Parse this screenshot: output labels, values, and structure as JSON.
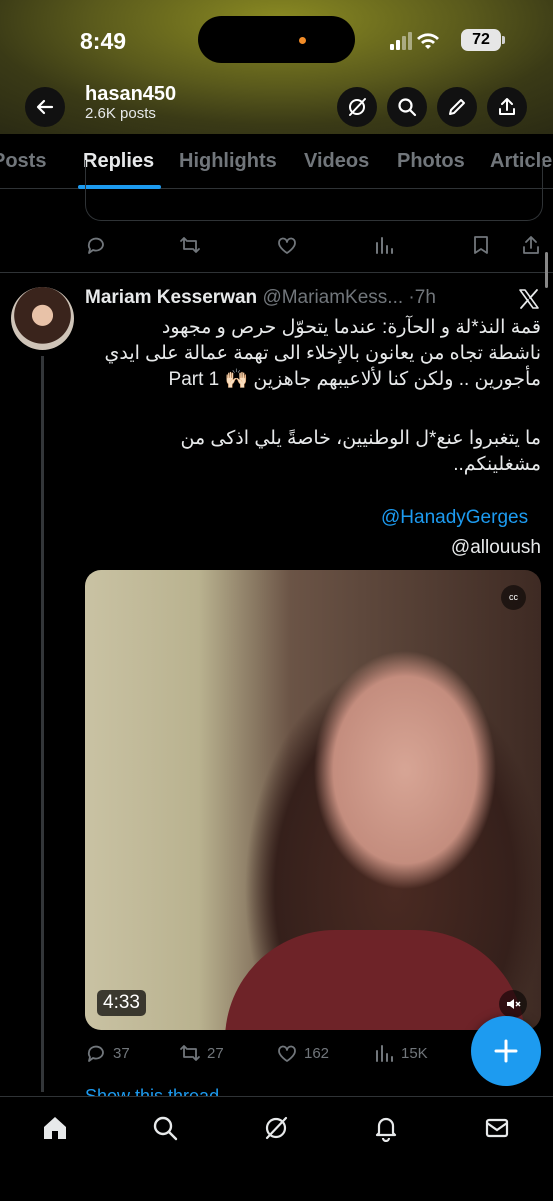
{
  "status_bar": {
    "time": "8:49",
    "battery": "72"
  },
  "profile": {
    "name": "hasan450",
    "posts": "2.6K posts"
  },
  "tabs": [
    "Posts",
    "Replies",
    "Highlights",
    "Videos",
    "Photos",
    "Articles"
  ],
  "active_tab": "Replies",
  "tweet": {
    "author_name": "Mariam Kesserwan",
    "handle": "@MariamKess...",
    "separator": "·",
    "time": "7h",
    "text_lines": [
      "قمة النذ*لة و الحآرة: عندما يتحوّل حرص و مجهود",
      "ناشطة تجاه من يعانون بالإخلاء الى تهمة عمالة على ايدي",
      "مأجورين .. ولكن كنا لألاعيبهم جاهزين 🙌🏻 Part 1",
      "",
      "ما يتغبروا عنع*ل الوطنيين، خاصةً يلي اذكى من",
      "مشغلينكم.."
    ],
    "mention": "@HanadyGerges",
    "mention2": "allouush@",
    "video": {
      "duration": "4:33",
      "cc_label": "cc"
    },
    "stats": {
      "replies": "37",
      "reposts": "27",
      "likes": "162",
      "views": "15K"
    }
  },
  "show_thread": "Show this thread",
  "colors": {
    "accent": "#1d9bf0",
    "background": "#000000",
    "muted": "#71767b"
  }
}
